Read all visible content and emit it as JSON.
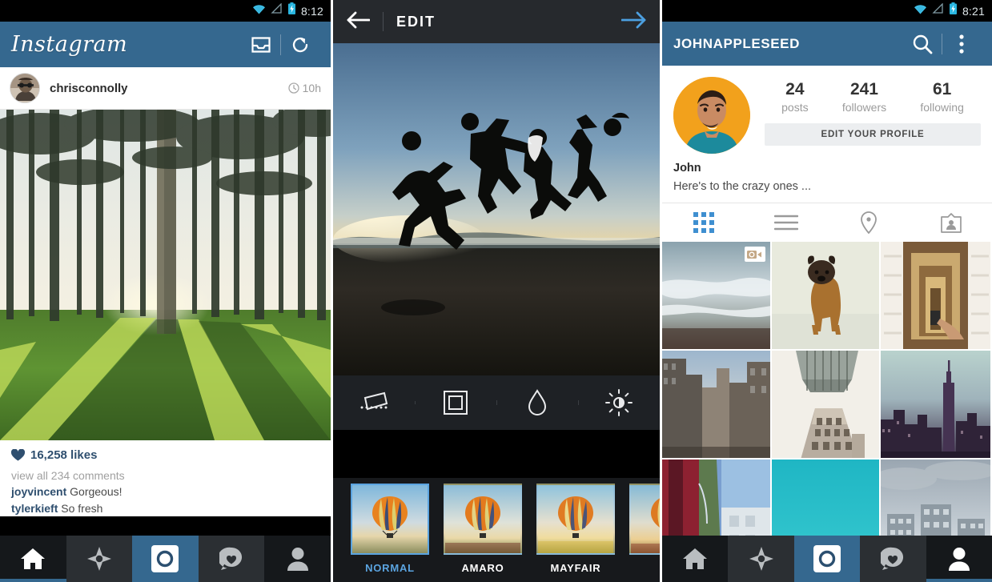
{
  "panels": {
    "feed": {
      "status": {
        "time": "8:12",
        "icons": [
          "wifi-icon",
          "signal-icon",
          "battery-charging-icon"
        ]
      },
      "header": {
        "logo": "Instagram",
        "inbox_icon": "inbox-icon",
        "refresh_icon": "refresh-icon"
      },
      "post": {
        "username": "chrisconnolly",
        "timestamp": "10h",
        "clock_icon": "clock-icon",
        "photo_alt": "sunlit forest with green grass",
        "heart_icon": "heart-filled-icon",
        "likes": "16,258 likes",
        "view_comments": "view all 234 comments",
        "comments": [
          {
            "user": "joyvincent",
            "text": "Gorgeous!"
          },
          {
            "user": "tylerkieft",
            "text": "So fresh"
          }
        ]
      },
      "tabbar": [
        {
          "name": "home",
          "icon": "home-icon",
          "active": false,
          "style": "first"
        },
        {
          "name": "explore",
          "icon": "compass-icon",
          "active": false,
          "style": ""
        },
        {
          "name": "camera",
          "icon": "camera-icon",
          "active": true,
          "style": ""
        },
        {
          "name": "activity",
          "icon": "heart-speech-icon",
          "active": false,
          "style": ""
        },
        {
          "name": "profile",
          "icon": "person-icon",
          "active": false,
          "style": "last"
        }
      ]
    },
    "edit": {
      "header": {
        "back_icon": "arrow-left-icon",
        "title": "EDIT",
        "next_icon": "arrow-right-icon"
      },
      "photo_alt": "four people jumping silhouetted against sunset",
      "tools": [
        {
          "name": "straighten",
          "icon": "straighten-icon"
        },
        {
          "name": "frame",
          "icon": "frame-icon"
        },
        {
          "name": "tilt-shift",
          "icon": "droplet-icon"
        },
        {
          "name": "lux",
          "icon": "brightness-icon"
        }
      ],
      "filters": [
        {
          "label": "NORMAL",
          "selected": true
        },
        {
          "label": "AMARO",
          "selected": false
        },
        {
          "label": "MAYFAIR",
          "selected": false
        },
        {
          "label": "",
          "selected": false
        }
      ]
    },
    "profile": {
      "status": {
        "time": "8:21",
        "icons": [
          "wifi-icon",
          "signal-icon",
          "battery-charging-icon"
        ]
      },
      "header": {
        "username": "JOHNAPPLESEED",
        "search_icon": "search-icon",
        "overflow_icon": "overflow-menu-icon"
      },
      "avatar_alt": "man in teal shirt on orange background",
      "stats": [
        {
          "value": "24",
          "label": "posts"
        },
        {
          "value": "241",
          "label": "followers"
        },
        {
          "value": "61",
          "label": "following"
        }
      ],
      "edit_profile": "EDIT YOUR PROFILE",
      "bio_name": "John",
      "bio_text": "Here's to the crazy ones ...",
      "view_tabs": [
        {
          "name": "grid-view",
          "icon": "grid-icon",
          "active": true
        },
        {
          "name": "list-view",
          "icon": "list-icon",
          "active": false
        },
        {
          "name": "map-view",
          "icon": "location-pin-icon",
          "active": false
        },
        {
          "name": "photos-of-you",
          "icon": "tagged-person-icon",
          "active": false
        }
      ],
      "grid": [
        {
          "alt": "ocean waves on beach",
          "video": true
        },
        {
          "alt": "pug dog sitting",
          "video": false
        },
        {
          "alt": "stairwell looking down",
          "video": false
        },
        {
          "alt": "city street buildings",
          "video": false
        },
        {
          "alt": "skyscraper looking up",
          "video": false
        },
        {
          "alt": "new york skyline at dusk",
          "video": false
        },
        {
          "alt": "red and blue city scene",
          "video": false
        },
        {
          "alt": "teal gradient",
          "video": false
        },
        {
          "alt": "cloudy apartment blocks",
          "video": false
        }
      ],
      "tabbar": [
        {
          "name": "home",
          "icon": "home-icon",
          "active": false,
          "style": "first"
        },
        {
          "name": "explore",
          "icon": "compass-icon",
          "active": false,
          "style": ""
        },
        {
          "name": "camera",
          "icon": "camera-icon",
          "active": true,
          "style": ""
        },
        {
          "name": "activity",
          "icon": "heart-speech-icon",
          "active": false,
          "style": ""
        },
        {
          "name": "profile",
          "icon": "person-icon",
          "active": false,
          "style": "last"
        }
      ]
    }
  },
  "colors": {
    "brand_blue": "#35688f",
    "accent_blue": "#5ba4e0",
    "dark_chrome": "#26292d",
    "nav_dark": "#2b2f33"
  }
}
